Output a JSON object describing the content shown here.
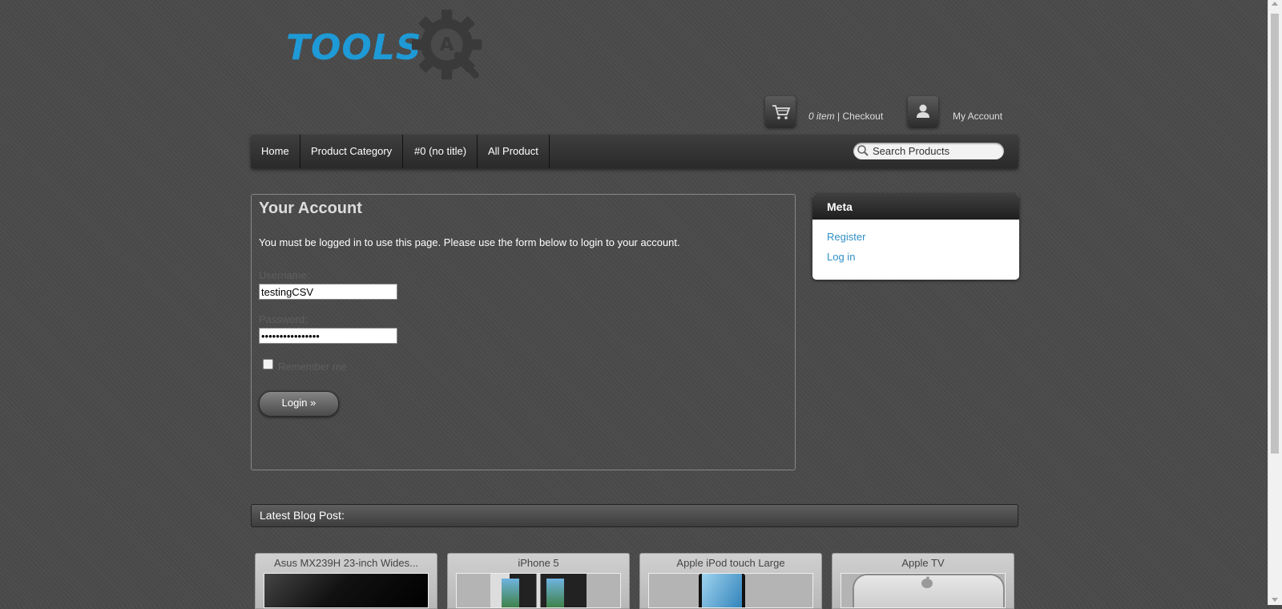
{
  "site": {
    "logo_text": "TOOLS",
    "logo_letter": "A",
    "accent": "#1e9ad6"
  },
  "header": {
    "cart_count": "0 item",
    "cart_separator": " | ",
    "checkout_label": "Checkout",
    "account_label": "My Account"
  },
  "nav": {
    "items": [
      {
        "label": "Home"
      },
      {
        "label": "Product Category"
      },
      {
        "label": "#0 (no title)"
      },
      {
        "label": "All Product"
      }
    ],
    "search_placeholder": "Search Products"
  },
  "account": {
    "title": "Your Account",
    "message": "You must be logged in to use this page. Please use the form below to login to your account.",
    "username_label": "Username:",
    "username_value": "testingCSV",
    "password_label": "Password:",
    "password_value": "testingCSVpass12",
    "remember_label": "Remember me",
    "remember_checked": false,
    "login_label": "Login »"
  },
  "meta": {
    "title": "Meta",
    "links": [
      {
        "label": "Register"
      },
      {
        "label": "Log in"
      }
    ],
    "link_color": "#2f8fc6"
  },
  "blog": {
    "heading": "Latest Blog Post:",
    "posts": [
      {
        "title": "Asus MX239H 23-inch Wides..."
      },
      {
        "title": "iPhone 5"
      },
      {
        "title": "Apple iPod touch Large"
      },
      {
        "title": "Apple TV"
      }
    ]
  }
}
